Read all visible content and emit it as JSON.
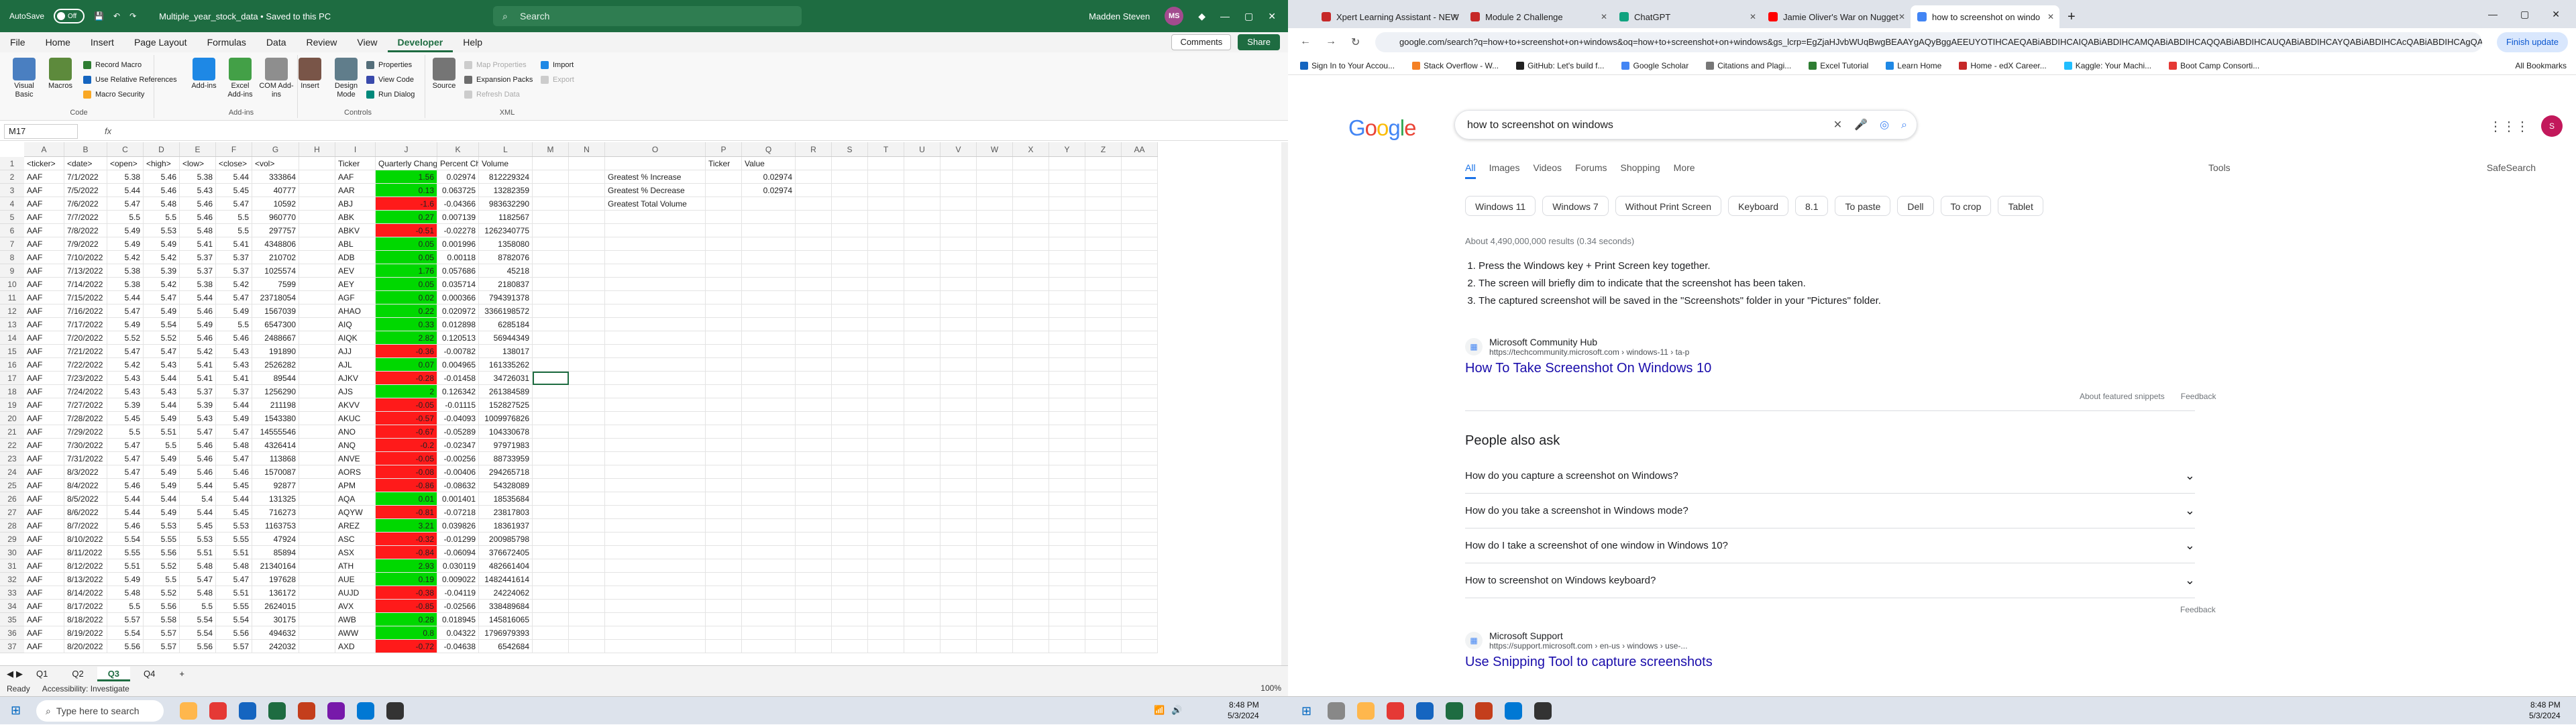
{
  "excel": {
    "autosave_label": "AutoSave",
    "autosave_state": "Off",
    "doc_title": "Multiple_year_stock_data • Saved to this PC",
    "search_placeholder": "Search",
    "user_name": "Madden Steven",
    "user_initials": "MS",
    "menu_tabs": [
      "File",
      "Home",
      "Insert",
      "Page Layout",
      "Formulas",
      "Data",
      "Review",
      "View",
      "Developer",
      "Help"
    ],
    "active_tab": "Developer",
    "comments_label": "Comments",
    "share_label": "Share",
    "ribbon": {
      "code_group": "Code",
      "visual_basic": "Visual Basic",
      "macros": "Macros",
      "record_macro": "Record Macro",
      "use_relative": "Use Relative References",
      "macro_security": "Macro Security",
      "addins_group": "Add-ins",
      "addins": "Add-ins",
      "excel_addins": "Excel Add-ins",
      "com_addins": "COM Add-ins",
      "controls_group": "Controls",
      "insert": "Insert",
      "design_mode": "Design Mode",
      "properties": "Properties",
      "view_code": "View Code",
      "run_dialog": "Run Dialog",
      "xml_group": "XML",
      "source": "Source",
      "map_properties": "Map Properties",
      "expansion_packs": "Expansion Packs",
      "refresh_data": "Refresh Data",
      "import": "Import",
      "export": "Export"
    },
    "name_box": "M17",
    "fx": "fx",
    "columns": [
      "A",
      "B",
      "C",
      "D",
      "E",
      "F",
      "G",
      "H",
      "I",
      "J",
      "K",
      "L",
      "M",
      "N",
      "O",
      "P",
      "Q",
      "R",
      "S",
      "T",
      "U",
      "V",
      "W",
      "X",
      "Y",
      "Z",
      "AA"
    ],
    "header_row": [
      "<ticker>",
      "<date>",
      "<open>",
      "<high>",
      "<low>",
      "<close>",
      "<vol>",
      "",
      "Ticker",
      "Quarterly Change",
      "Percent Ch",
      "Volume",
      "",
      "",
      "",
      "Ticker",
      "Value"
    ],
    "rows": [
      [
        "AAF",
        "7/1/2022",
        "5.38",
        "5.46",
        "5.38",
        "5.44",
        "333864",
        "",
        "AAF",
        "1.56",
        "0.02974",
        "812229324",
        "",
        "",
        "Greatest % Increase",
        "",
        "0.02974"
      ],
      [
        "AAF",
        "7/5/2022",
        "5.44",
        "5.46",
        "5.43",
        "5.45",
        "40777",
        "",
        "AAR",
        "0.13",
        "0.063725",
        "13282359",
        "",
        "",
        "Greatest % Decrease",
        "",
        "0.02974"
      ],
      [
        "AAF",
        "7/6/2022",
        "5.47",
        "5.48",
        "5.46",
        "5.47",
        "10592",
        "",
        "ABJ",
        "-1.6",
        "-0.04366",
        "983632290",
        "",
        "",
        "Greatest Total Volume",
        "",
        ""
      ],
      [
        "AAF",
        "7/7/2022",
        "5.5",
        "5.5",
        "5.46",
        "5.5",
        "960770",
        "",
        "ABK",
        "0.27",
        "0.007139",
        "1182567",
        "",
        "",
        "",
        "",
        ""
      ],
      [
        "AAF",
        "7/8/2022",
        "5.49",
        "5.53",
        "5.48",
        "5.5",
        "297757",
        "",
        "ABKV",
        "-0.51",
        "-0.02278",
        "1262340775",
        "",
        "",
        "",
        "",
        ""
      ],
      [
        "AAF",
        "7/9/2022",
        "5.49",
        "5.49",
        "5.41",
        "5.41",
        "4348806",
        "",
        "ABL",
        "0.05",
        "0.001996",
        "1358080",
        "",
        "",
        "",
        "",
        ""
      ],
      [
        "AAF",
        "7/10/2022",
        "5.42",
        "5.42",
        "5.37",
        "5.37",
        "210702",
        "",
        "ADB",
        "0.05",
        "0.00118",
        "8782076",
        "",
        "",
        "",
        "",
        ""
      ],
      [
        "AAF",
        "7/13/2022",
        "5.38",
        "5.39",
        "5.37",
        "5.37",
        "1025574",
        "",
        "AEV",
        "1.76",
        "0.057686",
        "45218",
        "",
        "",
        "",
        "",
        ""
      ],
      [
        "AAF",
        "7/14/2022",
        "5.38",
        "5.42",
        "5.38",
        "5.42",
        "7599",
        "",
        "AEY",
        "0.05",
        "0.035714",
        "2180837",
        "",
        "",
        "",
        "",
        ""
      ],
      [
        "AAF",
        "7/15/2022",
        "5.44",
        "5.47",
        "5.44",
        "5.47",
        "23718054",
        "",
        "AGF",
        "0.02",
        "0.000366",
        "794391378",
        "",
        "",
        "",
        "",
        ""
      ],
      [
        "AAF",
        "7/16/2022",
        "5.47",
        "5.49",
        "5.46",
        "5.49",
        "1567039",
        "",
        "AHAO",
        "0.22",
        "0.020972",
        "3366198572",
        "",
        "",
        "",
        "",
        ""
      ],
      [
        "AAF",
        "7/17/2022",
        "5.49",
        "5.54",
        "5.49",
        "5.5",
        "6547300",
        "",
        "AIQ",
        "0.33",
        "0.012898",
        "6285184",
        "",
        "",
        "",
        "",
        ""
      ],
      [
        "AAF",
        "7/20/2022",
        "5.52",
        "5.52",
        "5.46",
        "5.46",
        "2488667",
        "",
        "AIQK",
        "2.82",
        "0.120513",
        "56944349",
        "",
        "",
        "",
        "",
        ""
      ],
      [
        "AAF",
        "7/21/2022",
        "5.47",
        "5.47",
        "5.42",
        "5.43",
        "191890",
        "",
        "AJJ",
        "-0.36",
        "-0.00782",
        "138017",
        "",
        "",
        "",
        "",
        ""
      ],
      [
        "AAF",
        "7/22/2022",
        "5.42",
        "5.43",
        "5.41",
        "5.43",
        "2526282",
        "",
        "AJL",
        "0.07",
        "0.004965",
        "161335262",
        "",
        "",
        "",
        "",
        ""
      ],
      [
        "AAF",
        "7/23/2022",
        "5.43",
        "5.44",
        "5.41",
        "5.41",
        "89544",
        "",
        "AJKV",
        "-0.28",
        "-0.01458",
        "34726031",
        "",
        "",
        "",
        "",
        ""
      ],
      [
        "AAF",
        "7/24/2022",
        "5.43",
        "5.43",
        "5.37",
        "5.37",
        "1256290",
        "",
        "AJS",
        "2",
        "0.126342",
        "261384589",
        "",
        "",
        "",
        "",
        ""
      ],
      [
        "AAF",
        "7/27/2022",
        "5.39",
        "5.44",
        "5.39",
        "5.44",
        "211198",
        "",
        "AKVV",
        "-0.05",
        "-0.01115",
        "152827525",
        "",
        "",
        "",
        "",
        ""
      ],
      [
        "AAF",
        "7/28/2022",
        "5.45",
        "5.49",
        "5.43",
        "5.49",
        "1543380",
        "",
        "AKUC",
        "-0.57",
        "-0.04093",
        "1009976826",
        "",
        "",
        "",
        "",
        ""
      ],
      [
        "AAF",
        "7/29/2022",
        "5.5",
        "5.51",
        "5.47",
        "5.47",
        "14555546",
        "",
        "ANO",
        "-0.67",
        "-0.05289",
        "104330678",
        "",
        "",
        "",
        "",
        ""
      ],
      [
        "AAF",
        "7/30/2022",
        "5.47",
        "5.5",
        "5.46",
        "5.48",
        "4326414",
        "",
        "ANQ",
        "-0.2",
        "-0.02347",
        "97971983",
        "",
        "",
        "",
        "",
        ""
      ],
      [
        "AAF",
        "7/31/2022",
        "5.47",
        "5.49",
        "5.46",
        "5.47",
        "113868",
        "",
        "ANVE",
        "-0.05",
        "-0.00256",
        "88733959",
        "",
        "",
        "",
        "",
        ""
      ],
      [
        "AAF",
        "8/3/2022",
        "5.47",
        "5.49",
        "5.46",
        "5.46",
        "1570087",
        "",
        "AORS",
        "-0.08",
        "-0.00406",
        "294265718",
        "",
        "",
        "",
        "",
        ""
      ],
      [
        "AAF",
        "8/4/2022",
        "5.46",
        "5.49",
        "5.44",
        "5.45",
        "92877",
        "",
        "APM",
        "-0.86",
        "-0.08632",
        "54328089",
        "",
        "",
        "",
        "",
        ""
      ],
      [
        "AAF",
        "8/5/2022",
        "5.44",
        "5.44",
        "5.4",
        "5.44",
        "131325",
        "",
        "AQA",
        "0.01",
        "0.001401",
        "18535684",
        "",
        "",
        "",
        "",
        ""
      ],
      [
        "AAF",
        "8/6/2022",
        "5.44",
        "5.49",
        "5.44",
        "5.45",
        "716273",
        "",
        "AQYW",
        "-0.81",
        "-0.07218",
        "23817803",
        "",
        "",
        "",
        "",
        ""
      ],
      [
        "AAF",
        "8/7/2022",
        "5.46",
        "5.53",
        "5.45",
        "5.53",
        "1163753",
        "",
        "AREZ",
        "3.21",
        "0.039826",
        "18361937",
        "",
        "",
        "",
        "",
        ""
      ],
      [
        "AAF",
        "8/10/2022",
        "5.54",
        "5.55",
        "5.53",
        "5.55",
        "47924",
        "",
        "ASC",
        "-0.32",
        "-0.01299",
        "200985798",
        "",
        "",
        "",
        "",
        ""
      ],
      [
        "AAF",
        "8/11/2022",
        "5.55",
        "5.56",
        "5.51",
        "5.51",
        "85894",
        "",
        "ASX",
        "-0.84",
        "-0.06094",
        "376672405",
        "",
        "",
        "",
        "",
        ""
      ],
      [
        "AAF",
        "8/12/2022",
        "5.51",
        "5.52",
        "5.48",
        "5.48",
        "21340164",
        "",
        "ATH",
        "2.93",
        "0.030119",
        "482661404",
        "",
        "",
        "",
        "",
        ""
      ],
      [
        "AAF",
        "8/13/2022",
        "5.49",
        "5.5",
        "5.47",
        "5.47",
        "197628",
        "",
        "AUE",
        "0.19",
        "0.009022",
        "1482441614",
        "",
        "",
        "",
        "",
        ""
      ],
      [
        "AAF",
        "8/14/2022",
        "5.48",
        "5.52",
        "5.48",
        "5.51",
        "136172",
        "",
        "AUJD",
        "-0.38",
        "-0.04119",
        "24224062",
        "",
        "",
        "",
        "",
        ""
      ],
      [
        "AAF",
        "8/17/2022",
        "5.5",
        "5.56",
        "5.5",
        "5.55",
        "2624015",
        "",
        "AVX",
        "-0.85",
        "-0.02566",
        "338489684",
        "",
        "",
        "",
        "",
        ""
      ],
      [
        "AAF",
        "8/18/2022",
        "5.57",
        "5.58",
        "5.54",
        "5.54",
        "30175",
        "",
        "AWB",
        "0.28",
        "0.018945",
        "145816065",
        "",
        "",
        "",
        "",
        ""
      ],
      [
        "AAF",
        "8/19/2022",
        "5.54",
        "5.57",
        "5.54",
        "5.56",
        "494632",
        "",
        "AWW",
        "0.8",
        "0.04322",
        "1796979393",
        "",
        "",
        "",
        "",
        ""
      ],
      [
        "AAF",
        "8/20/2022",
        "5.56",
        "5.57",
        "5.56",
        "5.57",
        "242032",
        "",
        "AXD",
        "-0.72",
        "-0.04638",
        "6542684",
        "",
        "",
        "",
        "",
        ""
      ]
    ],
    "row_numbers": [
      "1",
      "2",
      "3",
      "4",
      "5",
      "6",
      "7",
      "8",
      "9",
      "10",
      "11",
      "12",
      "13",
      "14",
      "15",
      "16",
      "17",
      "18",
      "19",
      "20",
      "21",
      "22",
      "23",
      "24",
      "25",
      "26",
      "27",
      "28",
      "29",
      "30",
      "31",
      "32",
      "33",
      "34",
      "35",
      "36",
      "37"
    ],
    "sheets": [
      "Q1",
      "Q2",
      "Q3",
      "Q4"
    ],
    "active_sheet": "Q3",
    "add_sheet": "+",
    "status_ready": "Ready",
    "status_access": "Accessibility: Investigate",
    "zoom": "100%"
  },
  "chrome": {
    "tabs": [
      {
        "title": "Xpert Learning Assistant - NEW",
        "color": "#c62828"
      },
      {
        "title": "Module 2 Challenge",
        "color": "#c62828"
      },
      {
        "title": "ChatGPT",
        "color": "#10a37f"
      },
      {
        "title": "Jamie Oliver's War on Nugget",
        "color": "#ff0000"
      },
      {
        "title": "how to screenshot on windo",
        "color": "#4285f4"
      }
    ],
    "new_tab": "+",
    "url": "google.com/search?q=how+to+screenshot+on+windows&oq=how+to+screenshot+on+windows&gs_lcrp=EgZjaHJvbWUqBwgBEAAYgAQyBggAEEUYOTIHCAEQABiABDIHCAIQABiABDIHCAMQABiABDIHCAQQABiABDIHCAUQABiABDIHCAYQABiABDIHCAcQABiABDIHCAgQABiABDIHCAkQABiABNIBCDQzMDRqMGo3qAIAsAIA",
    "finish_update": "Finish update",
    "bookmarks": [
      "Sign In to Your Accou...",
      "Stack Overflow - W...",
      "GitHub: Let's build f...",
      "Google Scholar",
      "Citations and Plagi...",
      "Excel Tutorial",
      "Learn Home",
      "Home - edX Career...",
      "Kaggle: Your Machi...",
      "Boot Camp Consorti..."
    ],
    "all_bookmarks": "All Bookmarks"
  },
  "google": {
    "logo": "Google",
    "query": "how to screenshot on windows",
    "nav": [
      "All",
      "Images",
      "Videos",
      "Forums",
      "Shopping",
      "More"
    ],
    "tools": "Tools",
    "safesearch": "SafeSearch",
    "chips": [
      "Windows 11",
      "Windows 7",
      "Without Print Screen",
      "Keyboard",
      "8.1",
      "To paste",
      "Dell",
      "To crop",
      "Tablet"
    ],
    "result_count": "About 4,490,000,000 results (0.34 seconds)",
    "steps": [
      "Press the Windows key + Print Screen key together.",
      "The screen will briefly dim to indicate that the screenshot has been taken.",
      "The captured screenshot will be saved in the \"Screenshots\" folder in your \"Pictures\" folder."
    ],
    "src1_name": "Microsoft Community Hub",
    "src1_url": "https://techcommunity.microsoft.com › windows-11 › ta-p",
    "src1_title": "How To Take Screenshot On Windows 10",
    "about_snippets": "About featured snippets",
    "feedback": "Feedback",
    "paa_title": "People also ask",
    "paa": [
      "How do you capture a screenshot on Windows?",
      "How do you take a screenshot in Windows mode?",
      "How do I take a screenshot of one window in Windows 10?",
      "How to screenshot on Windows keyboard?"
    ],
    "src2_name": "Microsoft Support",
    "src2_url": "https://support.microsoft.com › en-us › windows › use-...",
    "src2_title": "Use Snipping Tool to capture screenshots",
    "user_initial": "S"
  },
  "taskbar": {
    "search_placeholder": "Type here to search",
    "time_left": "8:48 PM",
    "date_left": "5/3/2024",
    "time_right": "8:48 PM",
    "date_right": "5/3/2024"
  }
}
